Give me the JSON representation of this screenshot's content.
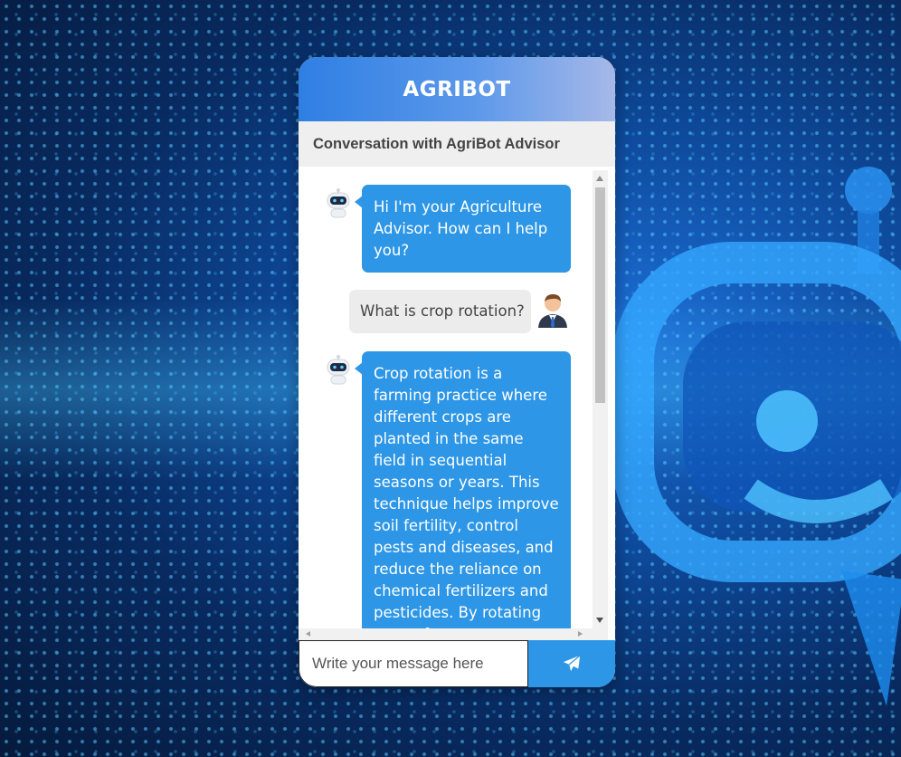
{
  "app": {
    "title": "AGRIBOT"
  },
  "chat": {
    "subtitle": "Conversation with AgriBot Advisor",
    "messages": [
      {
        "sender": "bot",
        "avatar": "robot-avatar-icon",
        "text": "Hi I'm your Agriculture Advisor. How can I help you?"
      },
      {
        "sender": "user",
        "avatar": "user-avatar-icon",
        "text": "What is crop rotation?"
      },
      {
        "sender": "bot",
        "avatar": "robot-avatar-icon",
        "text": "Crop rotation is a farming practice where different crops are planted in the same field in sequential seasons or years. This technique helps improve soil fertility, control pests and diseases, and reduce the reliance on chemical fertilizers and pesticides. By rotating crops, farmers can break the life cycles of pests and diseases"
      }
    ]
  },
  "composer": {
    "placeholder": "Write your message here",
    "send_icon": "send-icon"
  },
  "colors": {
    "accent": "#2d96e6",
    "header_start": "#2f7fe3",
    "header_end": "#a6b8e8",
    "user_bubble": "#ececec"
  }
}
